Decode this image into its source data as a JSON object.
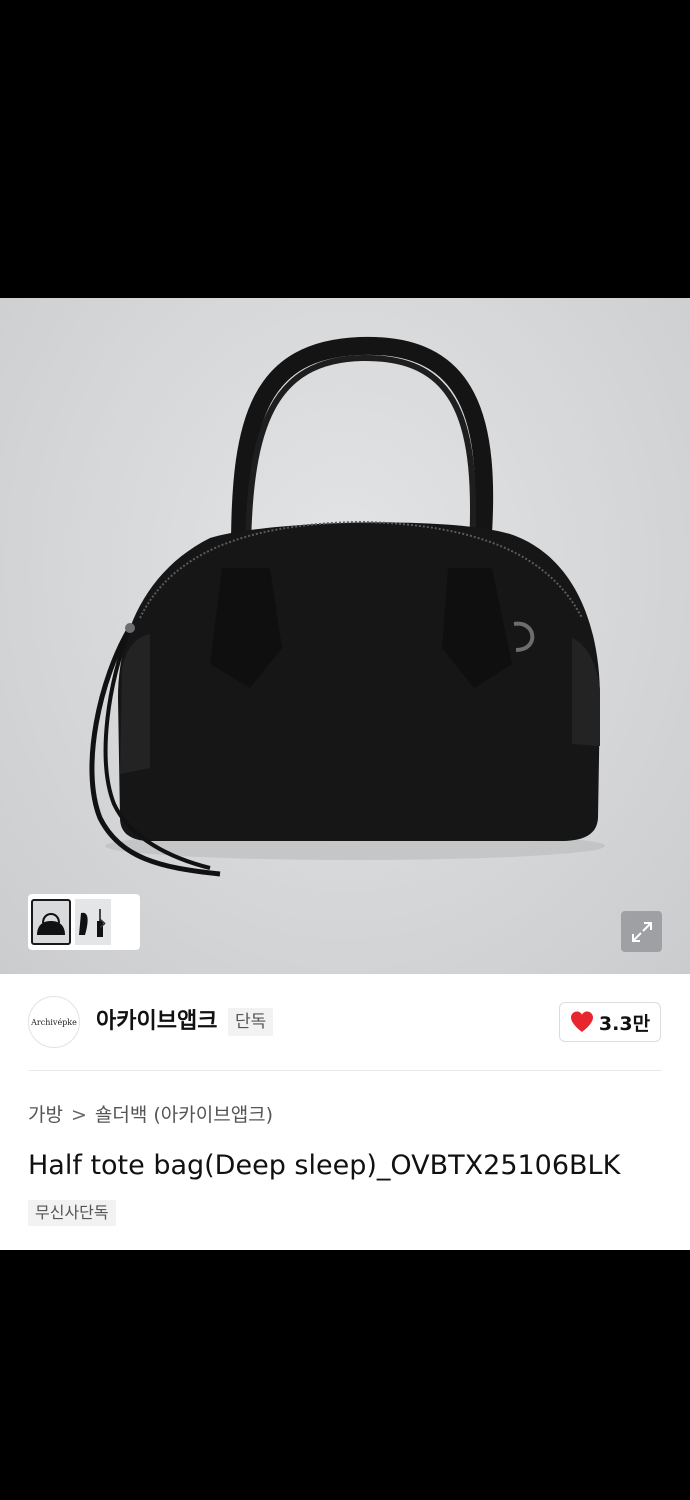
{
  "product": {
    "title": "Half tote bag(Deep sleep)_OVBTX25106BLK",
    "exclusive_tag": "무신사단독",
    "gallery": {
      "next_label": "›"
    }
  },
  "brand": {
    "logo_text": "Archivépke",
    "name": "아카이브앱크",
    "tag": "단독"
  },
  "like": {
    "count": "3.3만"
  },
  "breadcrumb": {
    "items": [
      "가방",
      "숄더백 (아카이브앱크)"
    ],
    "separator": ">"
  },
  "colors": {
    "heart": "#e8262d",
    "text": "#111111",
    "muted": "#555555"
  }
}
